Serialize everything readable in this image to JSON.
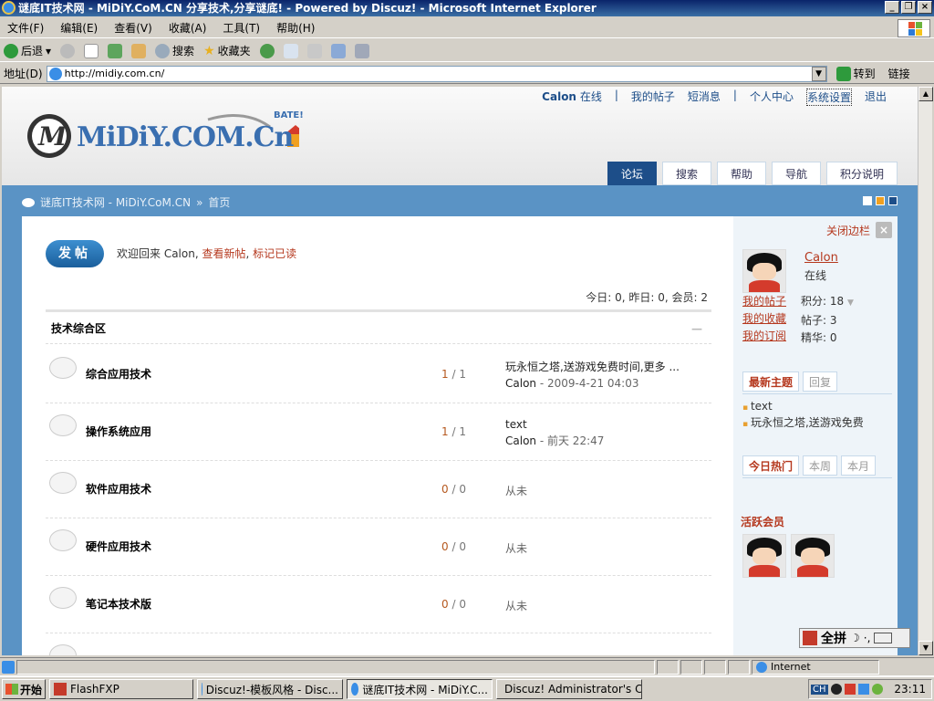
{
  "window": {
    "title": "谜底IT技术网 - MiDiY.CoM.CN 分享技术,分享谜底! - Powered by Discuz! - Microsoft Internet Explorer"
  },
  "menu": [
    "文件(F)",
    "编辑(E)",
    "查看(V)",
    "收藏(A)",
    "工具(T)",
    "帮助(H)"
  ],
  "toolbar": {
    "back": "后退",
    "search": "搜索",
    "favorites": "收藏夹"
  },
  "address": {
    "label": "地址(D)",
    "url": "http://midiy.com.cn/",
    "go": "转到",
    "links": "链接"
  },
  "header": {
    "user": "Calon",
    "online": "在线",
    "links": [
      "我的帖子",
      "短消息",
      "个人中心",
      "系统设置",
      "退出"
    ],
    "logo_text": "MiDiY.COM.Cn",
    "logo_tag": "BATE!"
  },
  "nav_tabs": [
    "论坛",
    "搜索",
    "帮助",
    "导航",
    "积分说明"
  ],
  "breadcrumb": {
    "site": "谜底IT技术网 - MiDiY.CoM.CN",
    "sep": "»",
    "current": "首页"
  },
  "main": {
    "post_button": "发帖",
    "welcome_prefix": "欢迎回来 Calon,",
    "new_posts": "查看新帖",
    "mark_read": "标记已读",
    "stats": "今日: 0, 昨日: 0, 会员: 2",
    "category": "技术综合区",
    "collapse": "—",
    "forums": [
      {
        "name": "综合应用技术",
        "topics": "1",
        "posts": "1",
        "last_title": "玩永恒之塔,送游戏免费时间,更多 ...",
        "last_user": "Calon",
        "last_time": "- 2009-4-21 04:03"
      },
      {
        "name": "操作系统应用",
        "topics": "1",
        "posts": "1",
        "last_title": "text",
        "last_user": "Calon",
        "last_time": "- 前天 22:47"
      },
      {
        "name": "软件应用技术",
        "topics": "0",
        "posts": "0",
        "never": "从未"
      },
      {
        "name": "硬件应用技术",
        "topics": "0",
        "posts": "0",
        "never": "从未"
      },
      {
        "name": "笔记本技术版",
        "topics": "0",
        "posts": "0",
        "never": "从未"
      }
    ]
  },
  "sidebar": {
    "close": "关闭边栏",
    "username": "Calon",
    "status": "在线",
    "links": [
      "我的帖子",
      "我的收藏",
      "我的订阅"
    ],
    "points": "积分: 18",
    "posts": "帖子: 3",
    "digest": "精华: 0",
    "tabs1": [
      "最新主题",
      "回复"
    ],
    "latest": [
      "text",
      "玩永恒之塔,送游戏免费"
    ],
    "tabs2": [
      "今日热门",
      "本周",
      "本月"
    ],
    "active_title": "活跃会员"
  },
  "ime": {
    "label": "全拼"
  },
  "statusbar": {
    "zone": "Internet"
  },
  "taskbar": {
    "start": "开始",
    "tasks": [
      "FlashFXP",
      "Discuz!-模板风格 - Disc...",
      "谜底IT技术网 - MiDiY.C...",
      "Discuz! Administrator's C..."
    ],
    "ime_indicator": "CH",
    "clock": "23:11"
  }
}
